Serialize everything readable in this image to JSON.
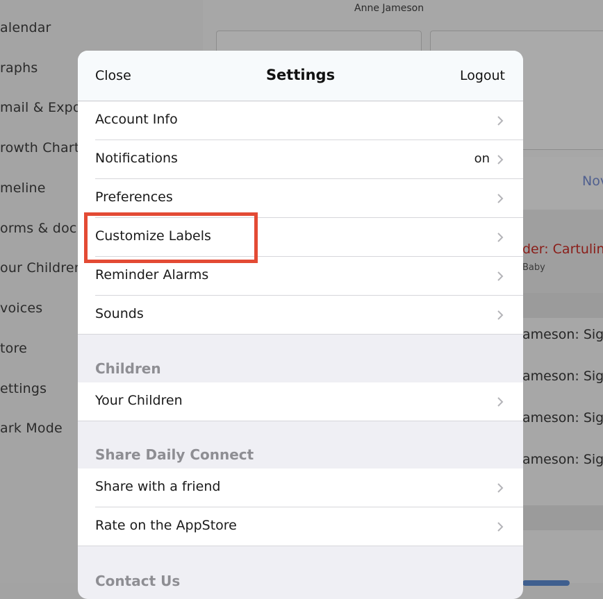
{
  "background": {
    "sidebar_items": [
      "alendar",
      "raphs",
      "mail & Expor",
      "rowth Chart",
      "meline",
      "orms & docu",
      "our Children",
      "voices",
      "tore",
      "ettings",
      "ark Mode"
    ],
    "user_name": "Anne Jameson",
    "nov_label": "Nov",
    "red_entry": "der: Cartulina",
    "baby_label": "Baby",
    "signatures": [
      "ameson: Sign",
      "ameson: Sign",
      "ameson: Sign",
      "ameson: Sign"
    ]
  },
  "modal": {
    "close_label": "Close",
    "title": "Settings",
    "logout_label": "Logout",
    "rows": [
      {
        "label": "Account Info",
        "value": ""
      },
      {
        "label": "Notifications",
        "value": "on"
      },
      {
        "label": "Preferences",
        "value": ""
      },
      {
        "label": "Customize Labels",
        "value": ""
      },
      {
        "label": "Reminder Alarms",
        "value": ""
      },
      {
        "label": "Sounds",
        "value": ""
      }
    ],
    "sections": {
      "children": {
        "header": "Children",
        "rows": [
          {
            "label": "Your Children"
          }
        ]
      },
      "share": {
        "header": "Share Daily Connect",
        "rows": [
          {
            "label": "Share with a friend"
          },
          {
            "label": "Rate on the AppStore"
          }
        ]
      },
      "contact": {
        "header": "Contact Us"
      }
    }
  },
  "highlight_color": "#e34a34"
}
